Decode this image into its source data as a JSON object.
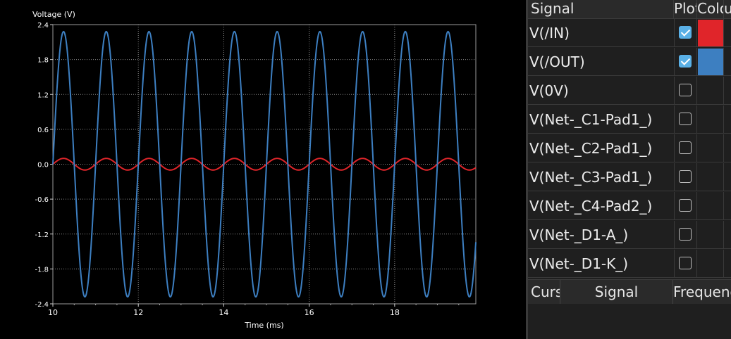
{
  "chart_data": {
    "type": "line",
    "ylabel": "Voltage (V)",
    "xlabel": "Time (ms)",
    "xlim": [
      10,
      19.9
    ],
    "ylim": [
      -2.4,
      2.4
    ],
    "xticks": [
      "10",
      "12",
      "14",
      "16",
      "18"
    ],
    "yticks": [
      "2.4",
      "1.8",
      "1.2",
      "0.6",
      "0.0",
      "-0.6",
      "-1.2",
      "-1.8",
      "-2.4"
    ],
    "grid": true,
    "series": [
      {
        "name": "V(/IN)",
        "color": "#e0252a",
        "amplitude": 0.1,
        "frequency_khz": 1
      },
      {
        "name": "V(/OUT)",
        "color": "#3d7fc1",
        "amplitude": 2.28,
        "frequency_khz": 1
      }
    ]
  },
  "signals_panel": {
    "headers": {
      "signal": "Signal",
      "plot": "Plot",
      "color": "Colour",
      "extra": "u"
    },
    "rows": [
      {
        "name": "V(/IN)",
        "plotted": true,
        "color": "#e0252a"
      },
      {
        "name": "V(/OUT)",
        "plotted": true,
        "color": "#3d7fc1"
      },
      {
        "name": "V(0V)",
        "plotted": false,
        "color": ""
      },
      {
        "name": "V(Net-_C1-Pad1_)",
        "plotted": false,
        "color": ""
      },
      {
        "name": "V(Net-_C2-Pad1_)",
        "plotted": false,
        "color": ""
      },
      {
        "name": "V(Net-_C3-Pad1_)",
        "plotted": false,
        "color": ""
      },
      {
        "name": "V(Net-_C4-Pad2_)",
        "plotted": false,
        "color": ""
      },
      {
        "name": "V(Net-_D1-A_)",
        "plotted": false,
        "color": ""
      },
      {
        "name": "V(Net-_D1-K_)",
        "plotted": false,
        "color": ""
      }
    ]
  },
  "cursors_panel": {
    "headers": {
      "cursor": "Cursor",
      "signal": "Signal",
      "frequency": "Frequency"
    }
  }
}
